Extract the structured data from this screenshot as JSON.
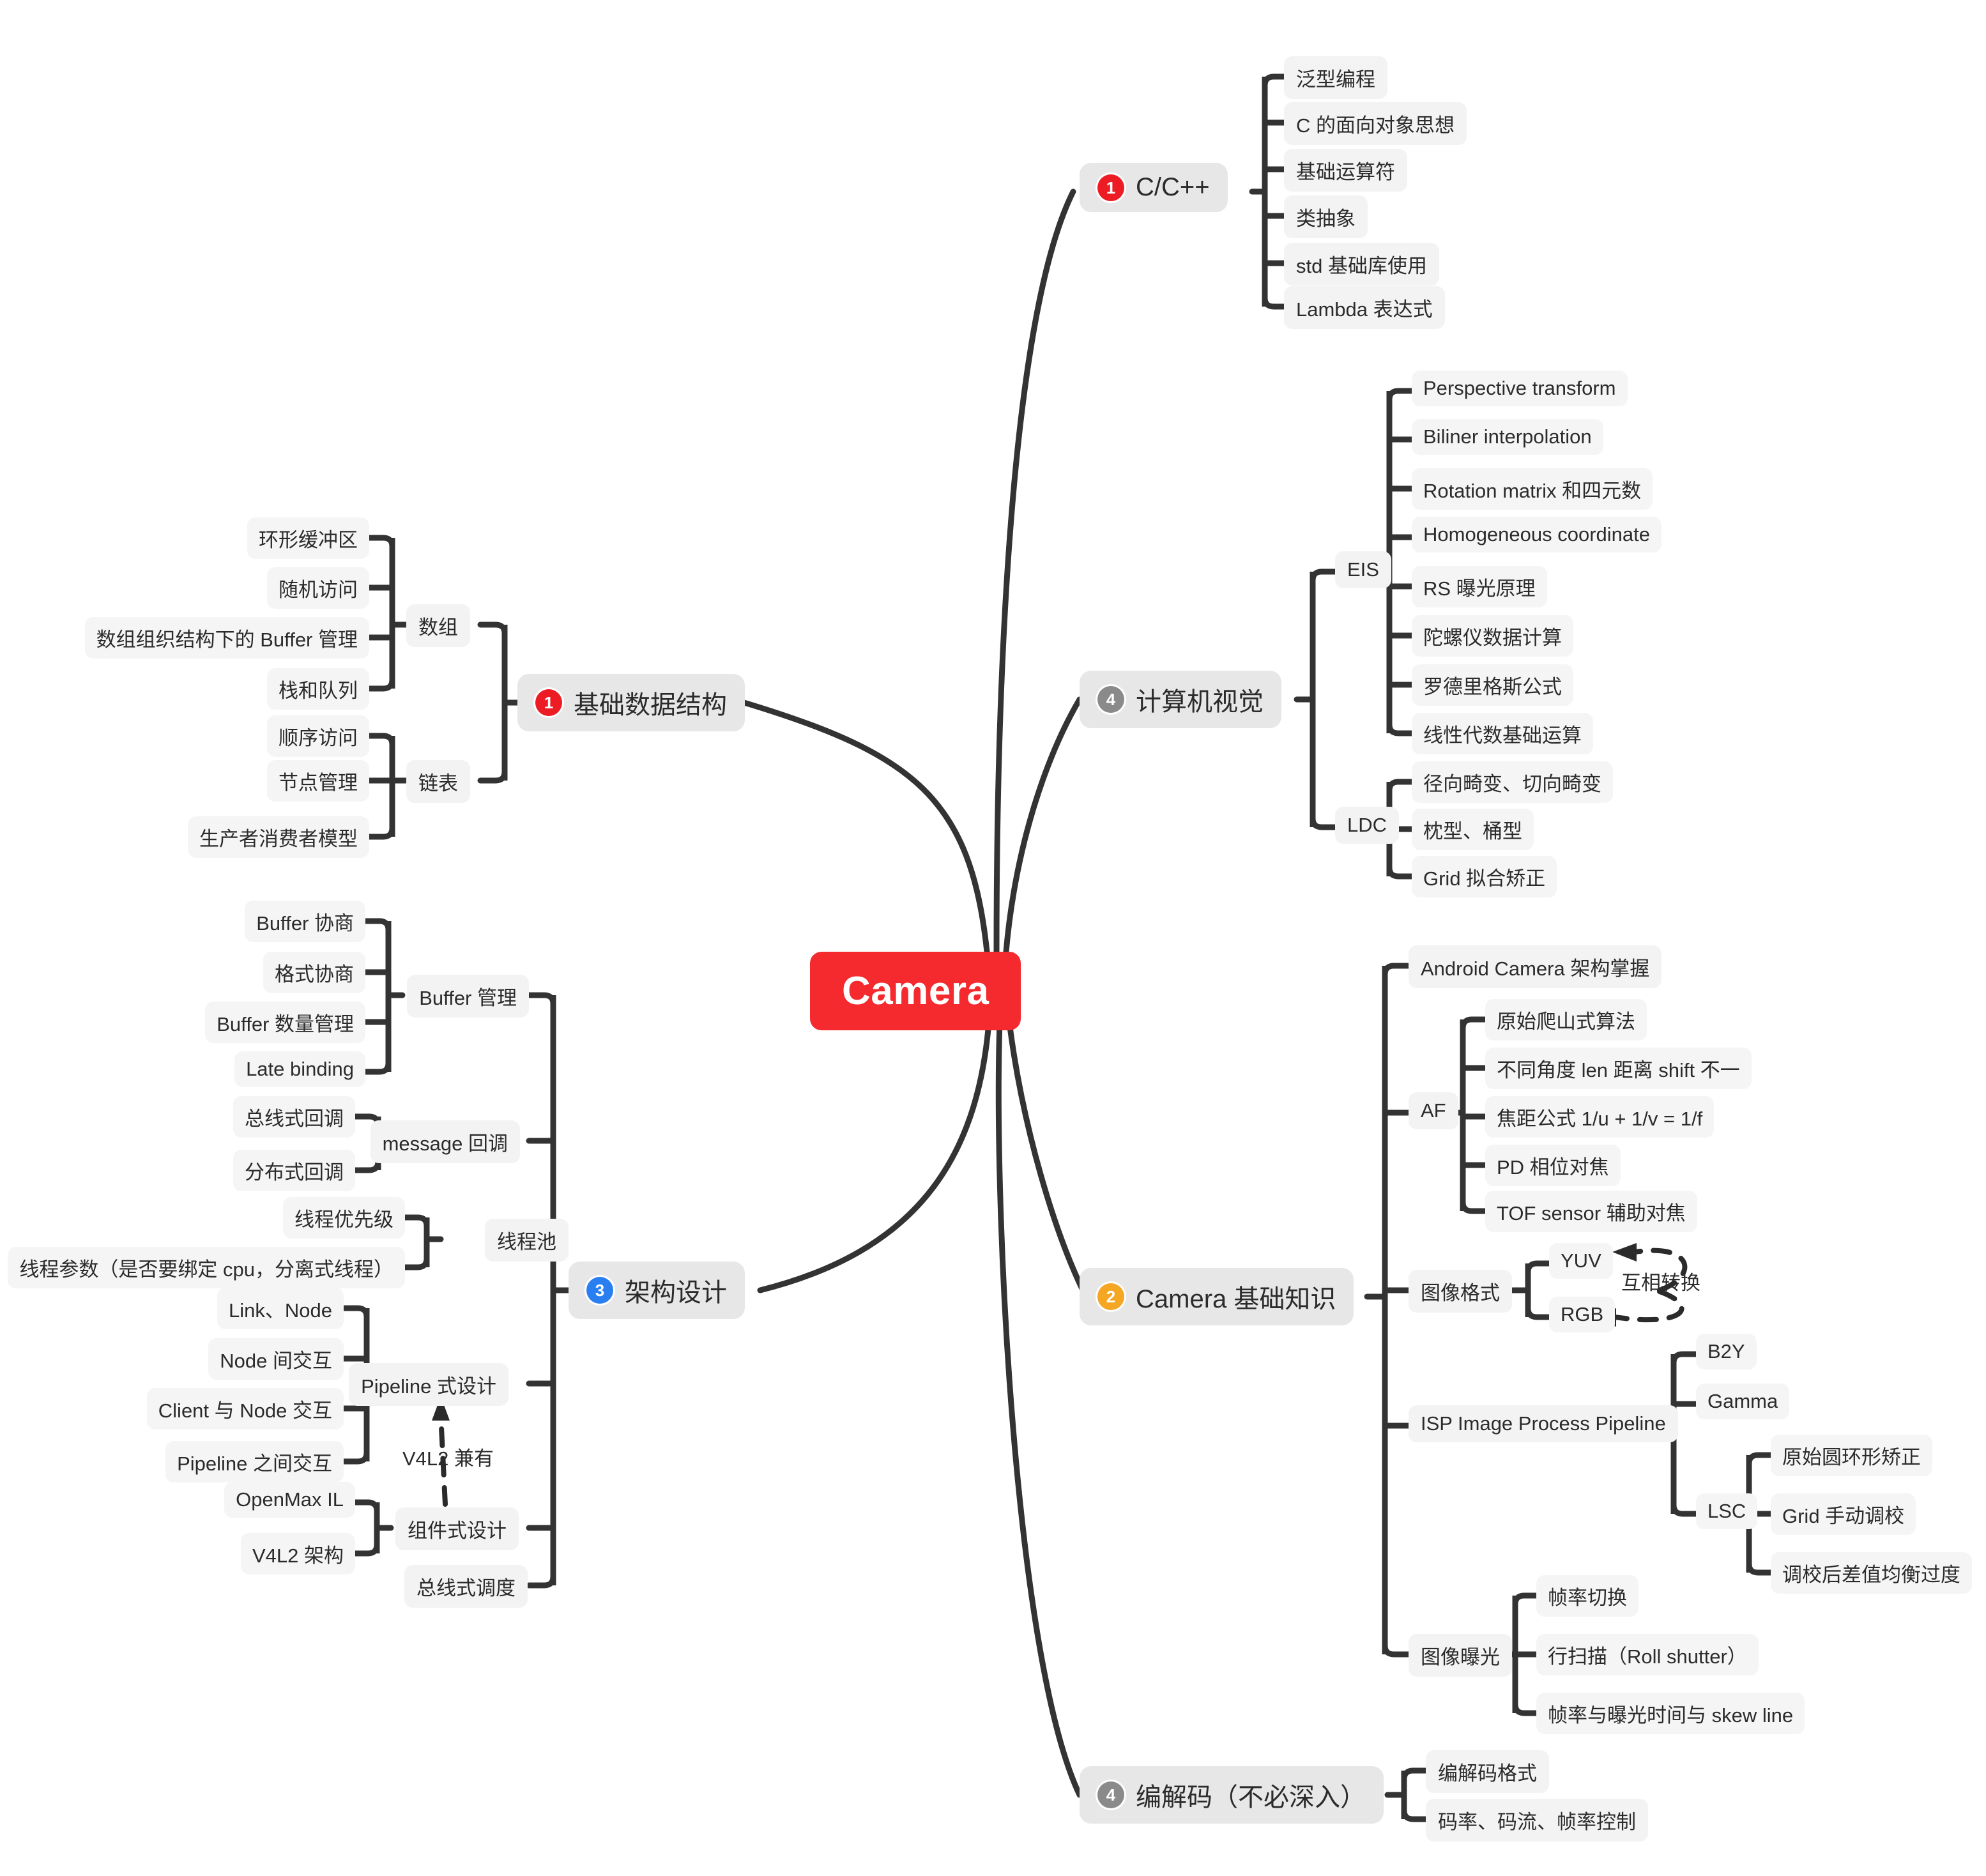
{
  "title": "Camera",
  "colors": {
    "root_bg": "#F42A2F",
    "lvl1_bg": "#E7E7E7",
    "leaf_bg": "#F3F3F3",
    "link": "#333333",
    "badge_red": "#ED1C24",
    "badge_orange": "#F5A623",
    "badge_blue": "#2A7FF0",
    "badge_gray": "#8A8A8A"
  },
  "root": {
    "label": "Camera"
  },
  "branches": {
    "cpp": {
      "badge": "1",
      "badge_color": "red",
      "label": "C/C++",
      "children": [
        {
          "label": "泛型编程"
        },
        {
          "label": "C 的面向对象思想"
        },
        {
          "label": "基础运算符"
        },
        {
          "label": "类抽象"
        },
        {
          "label": "std 基础库使用"
        },
        {
          "label": "Lambda 表达式"
        }
      ]
    },
    "cv": {
      "badge": "4",
      "badge_color": "gray",
      "label": "计算机视觉",
      "groups": [
        {
          "label": "EIS",
          "children": [
            {
              "label": "Perspective transform"
            },
            {
              "label": "Biliner interpolation"
            },
            {
              "label": "Rotation matrix 和四元数"
            },
            {
              "label": "Homogeneous coordinate"
            },
            {
              "label": "RS 曝光原理"
            },
            {
              "label": "陀螺仪数据计算"
            },
            {
              "label": "罗德里格斯公式"
            },
            {
              "label": "线性代数基础运算"
            }
          ]
        },
        {
          "label": "LDC",
          "children": [
            {
              "label": "径向畸变、切向畸变"
            },
            {
              "label": "枕型、桶型"
            },
            {
              "label": "Grid 拟合矫正"
            }
          ]
        }
      ]
    },
    "camera_basics": {
      "badge": "2",
      "badge_color": "orange",
      "label": "Camera 基础知识",
      "direct": [
        {
          "label": "Android Camera 架构掌握"
        }
      ],
      "groups": [
        {
          "label": "AF",
          "children": [
            {
              "label": "原始爬山式算法"
            },
            {
              "label": "不同角度 len 距离 shift 不一"
            },
            {
              "label": "焦距公式 1/u + 1/v = 1/f"
            },
            {
              "label": "PD 相位对焦"
            },
            {
              "label": "TOF sensor 辅助对焦"
            }
          ]
        },
        {
          "label": "图像格式",
          "children": [
            {
              "label": "YUV"
            },
            {
              "label": "RGB"
            }
          ],
          "annotation": "互相转换"
        },
        {
          "label": "ISP Image Process Pipeline",
          "children": [
            {
              "label": "B2Y"
            },
            {
              "label": "Gamma"
            },
            {
              "label": "LSC",
              "children": [
                {
                  "label": "原始圆环形矫正"
                },
                {
                  "label": "Grid 手动调校"
                },
                {
                  "label": "调校后差值均衡过度"
                }
              ]
            }
          ]
        },
        {
          "label": "图像曝光",
          "children": [
            {
              "label": "帧率切换"
            },
            {
              "label": "行扫描（Roll shutter）"
            },
            {
              "label": "帧率与曝光时间与 skew line"
            }
          ]
        }
      ]
    },
    "codec": {
      "badge": "4",
      "badge_color": "gray",
      "label": "编解码（不必深入）",
      "children": [
        {
          "label": "编解码格式"
        },
        {
          "label": "码率、码流、帧率控制"
        }
      ]
    },
    "data_structure": {
      "badge": "1",
      "badge_color": "red",
      "label": "基础数据结构",
      "groups": [
        {
          "label": "数组",
          "children": [
            {
              "label": "环形缓冲区"
            },
            {
              "label": "随机访问"
            },
            {
              "label": "数组组织结构下的 Buffer 管理"
            },
            {
              "label": "栈和队列"
            }
          ]
        },
        {
          "label": "链表",
          "children": [
            {
              "label": "顺序访问"
            },
            {
              "label": "节点管理"
            },
            {
              "label": "生产者消费者模型"
            }
          ]
        }
      ]
    },
    "architecture": {
      "badge": "3",
      "badge_color": "blue",
      "label": "架构设计",
      "groups": [
        {
          "label": "Buffer 管理",
          "children": [
            {
              "label": "Buffer 协商"
            },
            {
              "label": "格式协商"
            },
            {
              "label": "Buffer 数量管理"
            },
            {
              "label": "Late binding"
            }
          ]
        },
        {
          "label": "message 回调",
          "children": [
            {
              "label": "总线式回调"
            },
            {
              "label": "分布式回调"
            }
          ]
        },
        {
          "label": "线程池",
          "children": [
            {
              "label": "线程优先级"
            },
            {
              "label": "线程参数（是否要绑定 cpu，分离式线程）"
            }
          ]
        },
        {
          "label": "Pipeline 式设计",
          "children": [
            {
              "label": "Link、Node"
            },
            {
              "label": "Node 间交互"
            },
            {
              "label": "Client 与 Node 交互"
            },
            {
              "label": "Pipeline 之间交互"
            }
          ]
        },
        {
          "label": "组件式设计",
          "children": [
            {
              "label": "OpenMax IL"
            },
            {
              "label": "V4L2 架构"
            }
          ],
          "annotation": "V4L2 兼有"
        },
        {
          "label": "总线式调度",
          "children": []
        }
      ]
    }
  }
}
